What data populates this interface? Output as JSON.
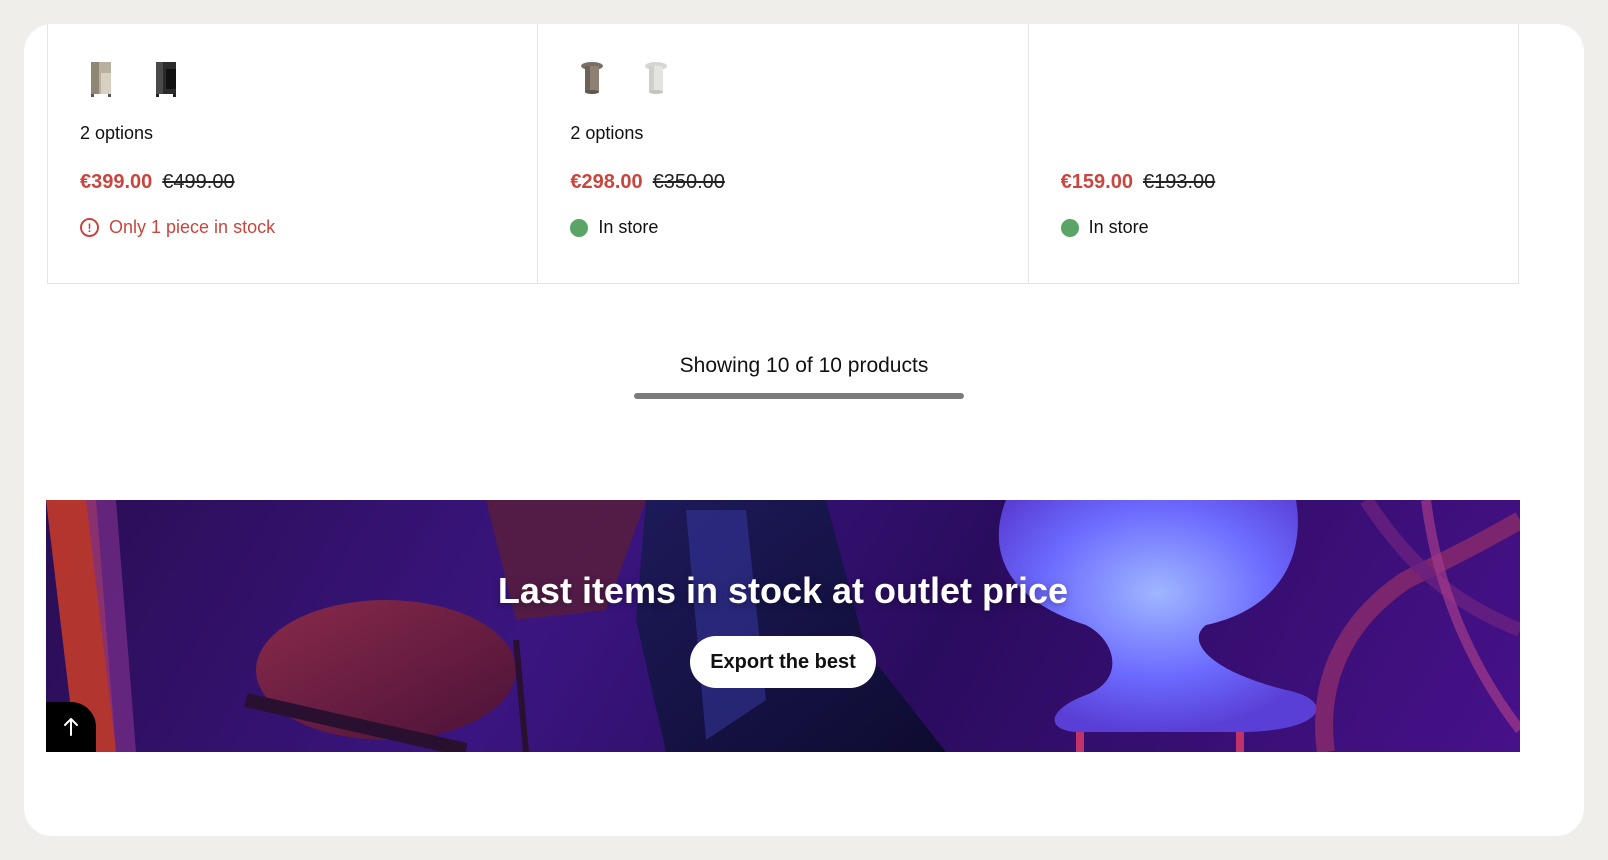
{
  "products": [
    {
      "swatch_icons": [
        "cabinet-beige-icon",
        "cabinet-black-icon"
      ],
      "options_label": "2 options",
      "price_sale": "€399.00",
      "price_original": "€499.00",
      "stock_text": "Only 1 piece in stock",
      "stock_status": "low"
    },
    {
      "swatch_icons": [
        "lamp-grey-icon",
        "lamp-white-icon"
      ],
      "options_label": "2 options",
      "price_sale": "€298.00",
      "price_original": "€350.00",
      "stock_text": "In store",
      "stock_status": "in-store"
    },
    {
      "swatch_icons": [],
      "options_label": "",
      "price_sale": "€159.00",
      "price_original": "€193.00",
      "stock_text": "In store",
      "stock_status": "in-store"
    }
  ],
  "pagination": {
    "showing_text": "Showing 10 of 10 products",
    "progress_fraction": 1.0
  },
  "banner": {
    "title": "Last items in stock at outlet price",
    "button_label": "Export the best"
  },
  "colors": {
    "sale_red": "#c9463f",
    "in_store_green": "#5aa566",
    "page_background": "#efeeeb"
  },
  "icons": {
    "low_stock": "exclamation-circle-icon",
    "in_store": "green-dot-icon",
    "back_to_top": "arrow-up-icon"
  }
}
